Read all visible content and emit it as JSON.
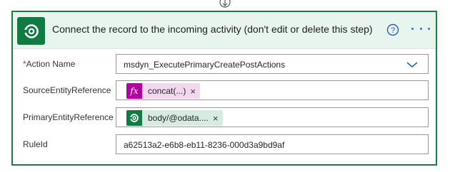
{
  "card": {
    "title": "Connect the record to the incoming activity (don't edit or delete this step)",
    "accent_color": "#1c7d43",
    "header_bg": "#e8f4ee",
    "icons": {
      "logo": "dataverse-logo-icon",
      "help": "help-circle-icon",
      "more": "more-options-icon",
      "connector": "add-step-connector-icon"
    }
  },
  "fields": {
    "action_name": {
      "required_marker": "*",
      "label": "Action Name",
      "value": "msdyn_ExecutePrimaryCreatePostActions"
    },
    "source_entity_reference": {
      "label": "SourceEntityReference",
      "token_icon": "fx",
      "token_text": "concat(...)",
      "remove": "×"
    },
    "primary_entity_reference": {
      "label": "PrimaryEntityReference",
      "token_text": "body/@odata....",
      "remove": "×"
    },
    "rule_id": {
      "label": "RuleId",
      "value": "a62513a2-e6b8-eb11-8236-000d3a9bd9af"
    }
  }
}
